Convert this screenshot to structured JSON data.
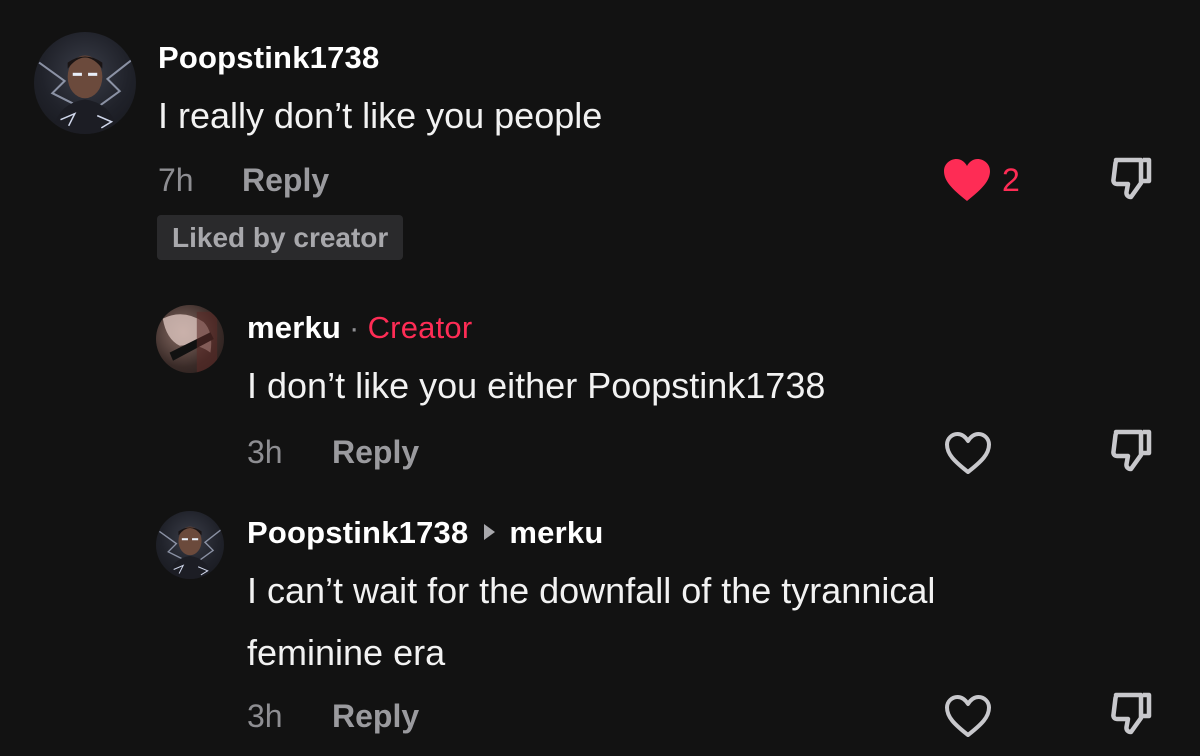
{
  "comments": [
    {
      "username": "Poopstink1738",
      "text": "I really don’t like you people",
      "time": "7h",
      "reply_label": "Reply",
      "liked": true,
      "like_count": "2",
      "badge": "Liked by creator"
    },
    {
      "username": "merku",
      "separator": "·",
      "creator_label": "Creator",
      "text": "I don’t like you either Poopstink1738",
      "time": "3h",
      "reply_label": "Reply",
      "liked": false
    },
    {
      "username": "Poopstink1738",
      "reply_to": "merku",
      "text_line1": "I can’t wait for the downfall of the tyrannical",
      "text_line2": "feminine era",
      "time": "3h",
      "reply_label": "Reply",
      "liked": false
    }
  ],
  "colors": {
    "background": "#121212",
    "accent_red": "#fe2c55",
    "secondary_text": "#8e8e92"
  },
  "icons": {
    "like_filled": "heart-filled-icon",
    "like_outline": "heart-outline-icon",
    "dislike": "thumbs-down-icon",
    "reply_arrow": "triangle-right-icon"
  }
}
